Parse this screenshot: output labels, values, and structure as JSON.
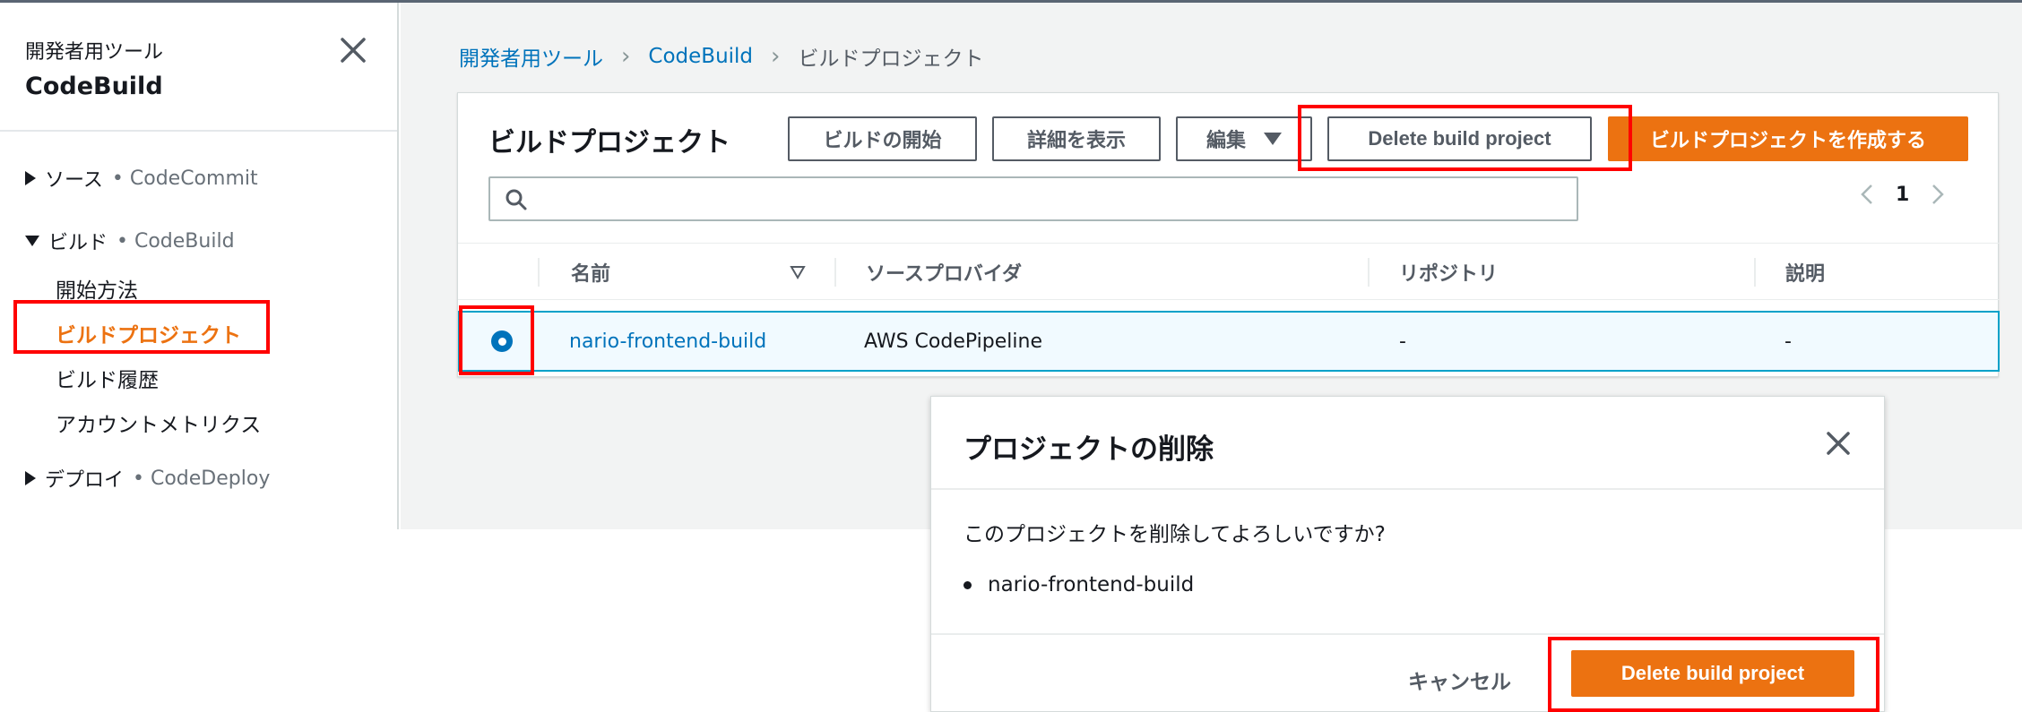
{
  "sidebar": {
    "subtitle": "開発者用ツール",
    "title": "CodeBuild",
    "sections": [
      {
        "label": "ソース",
        "service": "• CodeCommit",
        "expanded": false
      },
      {
        "label": "ビルド",
        "service": "• CodeBuild",
        "expanded": true
      },
      {
        "label": "デプロイ",
        "service": "• CodeDeploy",
        "expanded": false
      }
    ],
    "build_items": [
      "開始方法",
      "ビルドプロジェクト",
      "ビルド履歴",
      "アカウントメトリクス"
    ],
    "active_item": "ビルドプロジェクト"
  },
  "breadcrumb": [
    "開発者用ツール",
    "CodeBuild",
    "ビルドプロジェクト"
  ],
  "panel": {
    "title": "ビルドプロジェクト",
    "buttons": {
      "start": "ビルドの開始",
      "details": "詳細を表示",
      "edit": "編集",
      "delete": "Delete build project",
      "create": "ビルドプロジェクトを作成する"
    },
    "search_placeholder": "",
    "page": "1",
    "columns": [
      "名前",
      "ソースプロバイダ",
      "リポジトリ",
      "説明"
    ],
    "rows": [
      {
        "name": "nario-frontend-build",
        "provider": "AWS CodePipeline",
        "repository": "-",
        "description": "-",
        "selected": true
      }
    ]
  },
  "modal": {
    "title": "プロジェクトの削除",
    "question": "このプロジェクトを削除してよろしいですか?",
    "items": [
      "nario-frontend-build"
    ],
    "cancel_label": "キャンセル",
    "confirm_label": "Delete build project"
  },
  "colors": {
    "primary": "#ec7211",
    "link": "#0073bb",
    "highlight": "#ff0000",
    "selected_row_border": "#00a1c9"
  }
}
